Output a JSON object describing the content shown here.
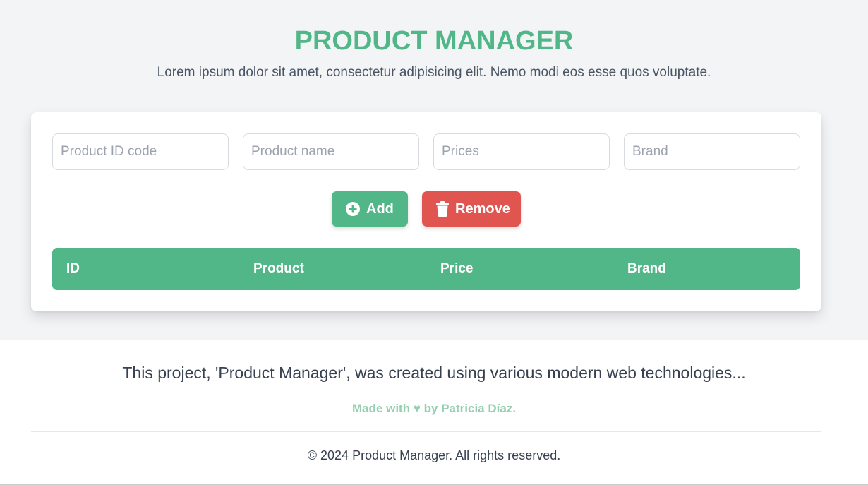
{
  "header": {
    "title": "PRODUCT MANAGER",
    "subtitle": "Lorem ipsum dolor sit amet, consectetur adipisicing elit. Nemo modi eos esse quos voluptate."
  },
  "form": {
    "id_placeholder": "Product ID code",
    "name_placeholder": "Product name",
    "price_placeholder": "Prices",
    "brand_placeholder": "Brand",
    "id_value": "",
    "name_value": "",
    "price_value": "",
    "brand_value": ""
  },
  "actions": {
    "add_label": "Add",
    "add_icon": "plus-circle-icon",
    "remove_label": "Remove",
    "remove_icon": "trash-icon"
  },
  "table": {
    "columns": [
      "ID",
      "Product",
      "Price",
      "Brand"
    ],
    "rows": []
  },
  "footer": {
    "description": "This project, 'Product Manager', was created using various modern web technologies...",
    "made_with": "Made with ♥ by Patricia Díaz.",
    "copyright": "© 2024 Product Manager. All rights reserved."
  },
  "colors": {
    "accent": "#52b788",
    "danger": "#e05550",
    "background": "#f3f4f6",
    "footer_accent": "#95cfb0"
  }
}
